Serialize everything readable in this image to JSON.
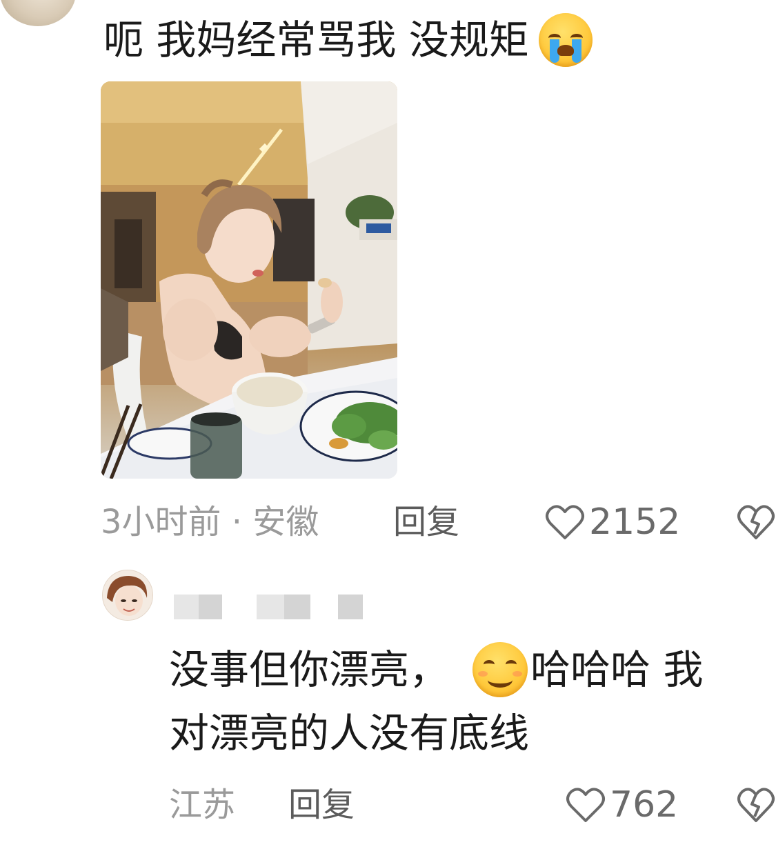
{
  "comment1": {
    "text": "呃 我妈经常骂我 没规矩",
    "emoji": "loudly-crying-face-icon",
    "photo": "photo-woman-eating-at-table",
    "time_location": "3小时前 · 安徽",
    "reply_label": "回复",
    "like_count": "2152"
  },
  "comment2": {
    "username": "",
    "line1_text": "没事但你漂亮，",
    "emoji": "smiling-face-icon",
    "line1_after_emoji": "哈哈哈 我",
    "line2_text": "对漂亮的人没有底线",
    "location": "江苏",
    "reply_label": "回复",
    "like_count": "762"
  },
  "colors": {
    "text_primary": "#1a1a1a",
    "text_meta": "#9a9a9a",
    "reply": "#5b5b5b",
    "like": "#6a6a6a"
  }
}
